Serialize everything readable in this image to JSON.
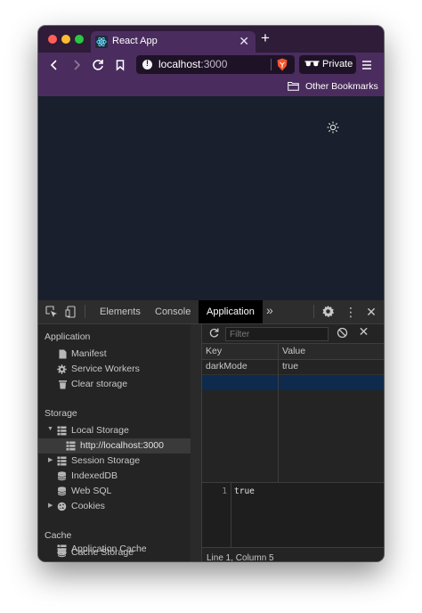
{
  "browser": {
    "tab_title": "React App",
    "url_host": "localhost",
    "url_port": ":3000",
    "private_label": "Private",
    "bookmarks_label": "Other Bookmarks",
    "accent": "#4a2d5e"
  },
  "devtools": {
    "tabs": [
      {
        "label": "Elements",
        "active": false
      },
      {
        "label": "Console",
        "active": false
      },
      {
        "label": "Application",
        "active": true
      }
    ],
    "sidebar": {
      "application_heading": "Application",
      "application_items": [
        "Manifest",
        "Service Workers",
        "Clear storage"
      ],
      "storage_heading": "Storage",
      "storage_items": [
        "Local Storage",
        "http://localhost:3000",
        "Session Storage",
        "IndexedDB",
        "Web SQL",
        "Cookies"
      ],
      "cache_heading": "Cache",
      "cache_items": [
        "Cache Storage",
        "Application Cache"
      ]
    },
    "storage": {
      "filter_placeholder": "Filter",
      "columns": [
        "Key",
        "Value"
      ],
      "rows": [
        {
          "key": "darkMode",
          "value": "true"
        }
      ],
      "editor_line_number": "1",
      "editor_value": "true",
      "status": "Line 1, Column 5"
    }
  }
}
